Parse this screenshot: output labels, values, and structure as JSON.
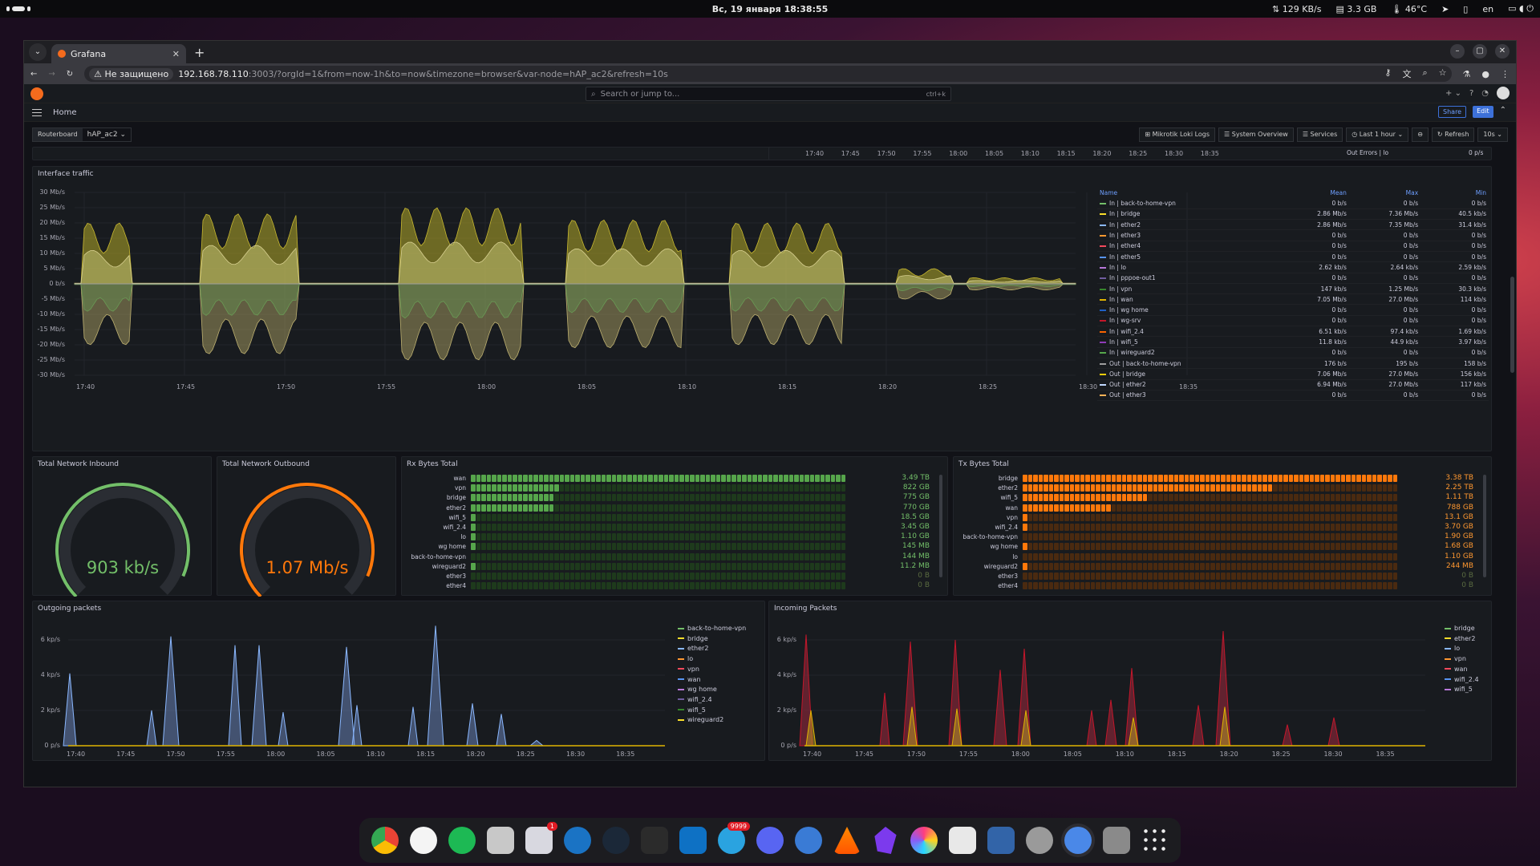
{
  "topbar": {
    "clock": "Вс, 19 января  18:38:55",
    "net": "129 KB/s",
    "mem": "3.3 GB",
    "temp": "46°C",
    "lang": "en"
  },
  "browser": {
    "tab_title": "Grafana",
    "warn": "Не защищено",
    "url_host": "192.168.78.110",
    "url_rest": ":3003/?orgId=1&from=now-1h&to=now&timezone=browser&var-node=hAP_ac2&refresh=10s"
  },
  "grafana": {
    "search_placeholder": "Search or jump to...",
    "search_kbd": "ctrl+k",
    "breadcrumb": "Home",
    "share": "Share",
    "edit": "Edit",
    "var_label": "Routerboard",
    "var_value": "hAP_ac2",
    "links": [
      "Mikrotik Loki Logs",
      "System Overview",
      "Services"
    ],
    "timerange": "Last 1 hour",
    "refresh": "Refresh",
    "refresh_interval": "10s"
  },
  "top_strip": {
    "times": [
      "17:40",
      "17:45",
      "17:50",
      "17:55",
      "18:00",
      "18:05",
      "18:10",
      "18:15",
      "18:20",
      "18:25",
      "18:30",
      "18:35"
    ],
    "legend_name": "Out Errors | lo",
    "legend_val": "0 p/s"
  },
  "traffic": {
    "title": "Interface traffic",
    "yticks": [
      "30 Mb/s",
      "25 Mb/s",
      "20 Mb/s",
      "15 Mb/s",
      "10 Mb/s",
      "5 Mb/s",
      "0 b/s",
      "-5 Mb/s",
      "-10 Mb/s",
      "-15 Mb/s",
      "-20 Mb/s",
      "-25 Mb/s",
      "-30 Mb/s"
    ],
    "xticks": [
      "17:40",
      "17:45",
      "17:50",
      "17:55",
      "18:00",
      "18:05",
      "18:10",
      "18:15",
      "18:20",
      "18:25",
      "18:30",
      "18:35"
    ],
    "legend_headers": [
      "Name",
      "Mean",
      "Max",
      "Min"
    ],
    "legend": [
      {
        "name": "In | back-to-home-vpn",
        "mean": "0 b/s",
        "max": "0 b/s",
        "min": "0 b/s",
        "color": "#73bf69"
      },
      {
        "name": "In | bridge",
        "mean": "2.86 Mb/s",
        "max": "7.36 Mb/s",
        "min": "40.5 kb/s",
        "color": "#fade2a"
      },
      {
        "name": "In | ether2",
        "mean": "2.86 Mb/s",
        "max": "7.35 Mb/s",
        "min": "31.4 kb/s",
        "color": "#8ab8ff"
      },
      {
        "name": "In | ether3",
        "mean": "0 b/s",
        "max": "0 b/s",
        "min": "0 b/s",
        "color": "#ff9830"
      },
      {
        "name": "In | ether4",
        "mean": "0 b/s",
        "max": "0 b/s",
        "min": "0 b/s",
        "color": "#f2495c"
      },
      {
        "name": "In | ether5",
        "mean": "0 b/s",
        "max": "0 b/s",
        "min": "0 b/s",
        "color": "#5794f2"
      },
      {
        "name": "In | lo",
        "mean": "2.62 kb/s",
        "max": "2.64 kb/s",
        "min": "2.59 kb/s",
        "color": "#b877d9"
      },
      {
        "name": "In | pppoe-out1",
        "mean": "0 b/s",
        "max": "0 b/s",
        "min": "0 b/s",
        "color": "#705da0"
      },
      {
        "name": "In | vpn",
        "mean": "147 kb/s",
        "max": "1.25 Mb/s",
        "min": "30.3 kb/s",
        "color": "#37872d"
      },
      {
        "name": "In | wan",
        "mean": "7.05 Mb/s",
        "max": "27.0 Mb/s",
        "min": "114 kb/s",
        "color": "#e0b400"
      },
      {
        "name": "In | wg home",
        "mean": "0 b/s",
        "max": "0 b/s",
        "min": "0 b/s",
        "color": "#1f60c4"
      },
      {
        "name": "In | wg-srv",
        "mean": "0 b/s",
        "max": "0 b/s",
        "min": "0 b/s",
        "color": "#c4162a"
      },
      {
        "name": "In | wifi_2.4",
        "mean": "6.51 kb/s",
        "max": "97.4 kb/s",
        "min": "1.69 kb/s",
        "color": "#fa6400"
      },
      {
        "name": "In | wifi_5",
        "mean": "11.8 kb/s",
        "max": "44.9 kb/s",
        "min": "3.97 kb/s",
        "color": "#8f3bb8"
      },
      {
        "name": "In | wireguard2",
        "mean": "0 b/s",
        "max": "0 b/s",
        "min": "0 b/s",
        "color": "#56a64b"
      },
      {
        "name": "Out | back-to-home-vpn",
        "mean": "176 b/s",
        "max": "195 b/s",
        "min": "158 b/s",
        "color": "#9e9e9e"
      },
      {
        "name": "Out | bridge",
        "mean": "7.06 Mb/s",
        "max": "27.0 Mb/s",
        "min": "156 kb/s",
        "color": "#f2cc0c"
      },
      {
        "name": "Out | ether2",
        "mean": "6.94 Mb/s",
        "max": "27.0 Mb/s",
        "min": "117 kb/s",
        "color": "#c0d8ff"
      },
      {
        "name": "Out | ether3",
        "mean": "0 b/s",
        "max": "0 b/s",
        "min": "0 b/s",
        "color": "#ffb357"
      }
    ]
  },
  "gauge_in": {
    "title": "Total Network Inbound",
    "value": "903 kb/s",
    "fraction": 0.92,
    "color": "#73bf69"
  },
  "gauge_out": {
    "title": "Total Network Outbound",
    "value": "1.07 Mb/s",
    "fraction": 0.92,
    "color": "#ff780a"
  },
  "rx": {
    "title": "Rx Bytes Total",
    "rows": [
      {
        "label": "wan",
        "value": "3.49 TB",
        "fill": 1.0
      },
      {
        "label": "vpn",
        "value": "822 GB",
        "fill": 0.24
      },
      {
        "label": "bridge",
        "value": "775 GB",
        "fill": 0.22
      },
      {
        "label": "ether2",
        "value": "770 GB",
        "fill": 0.22
      },
      {
        "label": "wifi_5",
        "value": "18.5 GB",
        "fill": 0.01
      },
      {
        "label": "wifi_2.4",
        "value": "3.45 GB",
        "fill": 0.01
      },
      {
        "label": "lo",
        "value": "1.10 GB",
        "fill": 0.01
      },
      {
        "label": "wg home",
        "value": "145 MB",
        "fill": 0.01
      },
      {
        "label": "back-to-home-vpn",
        "value": "144 MB",
        "fill": 0.0
      },
      {
        "label": "wireguard2",
        "value": "11.2 MB",
        "fill": 0.01
      },
      {
        "label": "ether3",
        "value": "0 B",
        "fill": 0.0
      },
      {
        "label": "ether4",
        "value": "0 B",
        "fill": 0.0
      }
    ]
  },
  "tx": {
    "title": "Tx Bytes Total",
    "rows": [
      {
        "label": "bridge",
        "value": "3.38 TB",
        "fill": 1.0
      },
      {
        "label": "ether2",
        "value": "2.25 TB",
        "fill": 0.67
      },
      {
        "label": "wifi_5",
        "value": "1.11 TB",
        "fill": 0.33
      },
      {
        "label": "wan",
        "value": "788 GB",
        "fill": 0.23
      },
      {
        "label": "vpn",
        "value": "13.1 GB",
        "fill": 0.01
      },
      {
        "label": "wifi_2.4",
        "value": "3.70 GB",
        "fill": 0.01
      },
      {
        "label": "back-to-home-vpn",
        "value": "1.90 GB",
        "fill": 0.0
      },
      {
        "label": "wg home",
        "value": "1.68 GB",
        "fill": 0.01
      },
      {
        "label": "lo",
        "value": "1.10 GB",
        "fill": 0.0
      },
      {
        "label": "wireguard2",
        "value": "244 MB",
        "fill": 0.01
      },
      {
        "label": "ether3",
        "value": "0 B",
        "fill": 0.0
      },
      {
        "label": "ether4",
        "value": "0 B",
        "fill": 0.0
      }
    ]
  },
  "out_packets": {
    "title": "Outgoing packets",
    "yticks": [
      "6 kp/s",
      "4 kp/s",
      "2 kp/s",
      "0 p/s"
    ],
    "xticks": [
      "17:40",
      "17:45",
      "17:50",
      "17:55",
      "18:00",
      "18:05",
      "18:10",
      "18:15",
      "18:20",
      "18:25",
      "18:30",
      "18:35"
    ],
    "legend": [
      {
        "name": "back-to-home-vpn",
        "color": "#73bf69"
      },
      {
        "name": "bridge",
        "color": "#fade2a"
      },
      {
        "name": "ether2",
        "color": "#8ab8ff"
      },
      {
        "name": "lo",
        "color": "#ff9830"
      },
      {
        "name": "vpn",
        "color": "#f2495c"
      },
      {
        "name": "wan",
        "color": "#5794f2"
      },
      {
        "name": "wg home",
        "color": "#b877d9"
      },
      {
        "name": "wifi_2.4",
        "color": "#705da0"
      },
      {
        "name": "wifi_5",
        "color": "#37872d"
      },
      {
        "name": "wireguard2",
        "color": "#fade2a"
      }
    ]
  },
  "in_packets": {
    "title": "Incoming Packets",
    "yticks": [
      "6 kp/s",
      "4 kp/s",
      "2 kp/s",
      "0 p/s"
    ],
    "xticks": [
      "17:40",
      "17:45",
      "17:50",
      "17:55",
      "18:00",
      "18:05",
      "18:10",
      "18:15",
      "18:20",
      "18:25",
      "18:30",
      "18:35"
    ],
    "legend": [
      {
        "name": "bridge",
        "color": "#73bf69"
      },
      {
        "name": "ether2",
        "color": "#fade2a"
      },
      {
        "name": "lo",
        "color": "#8ab8ff"
      },
      {
        "name": "vpn",
        "color": "#ff9830"
      },
      {
        "name": "wan",
        "color": "#f2495c"
      },
      {
        "name": "wifi_2.4",
        "color": "#5794f2"
      },
      {
        "name": "wifi_5",
        "color": "#b877d9"
      }
    ]
  },
  "dock": {
    "badge_store": "1",
    "badge_telegram": "9999"
  }
}
